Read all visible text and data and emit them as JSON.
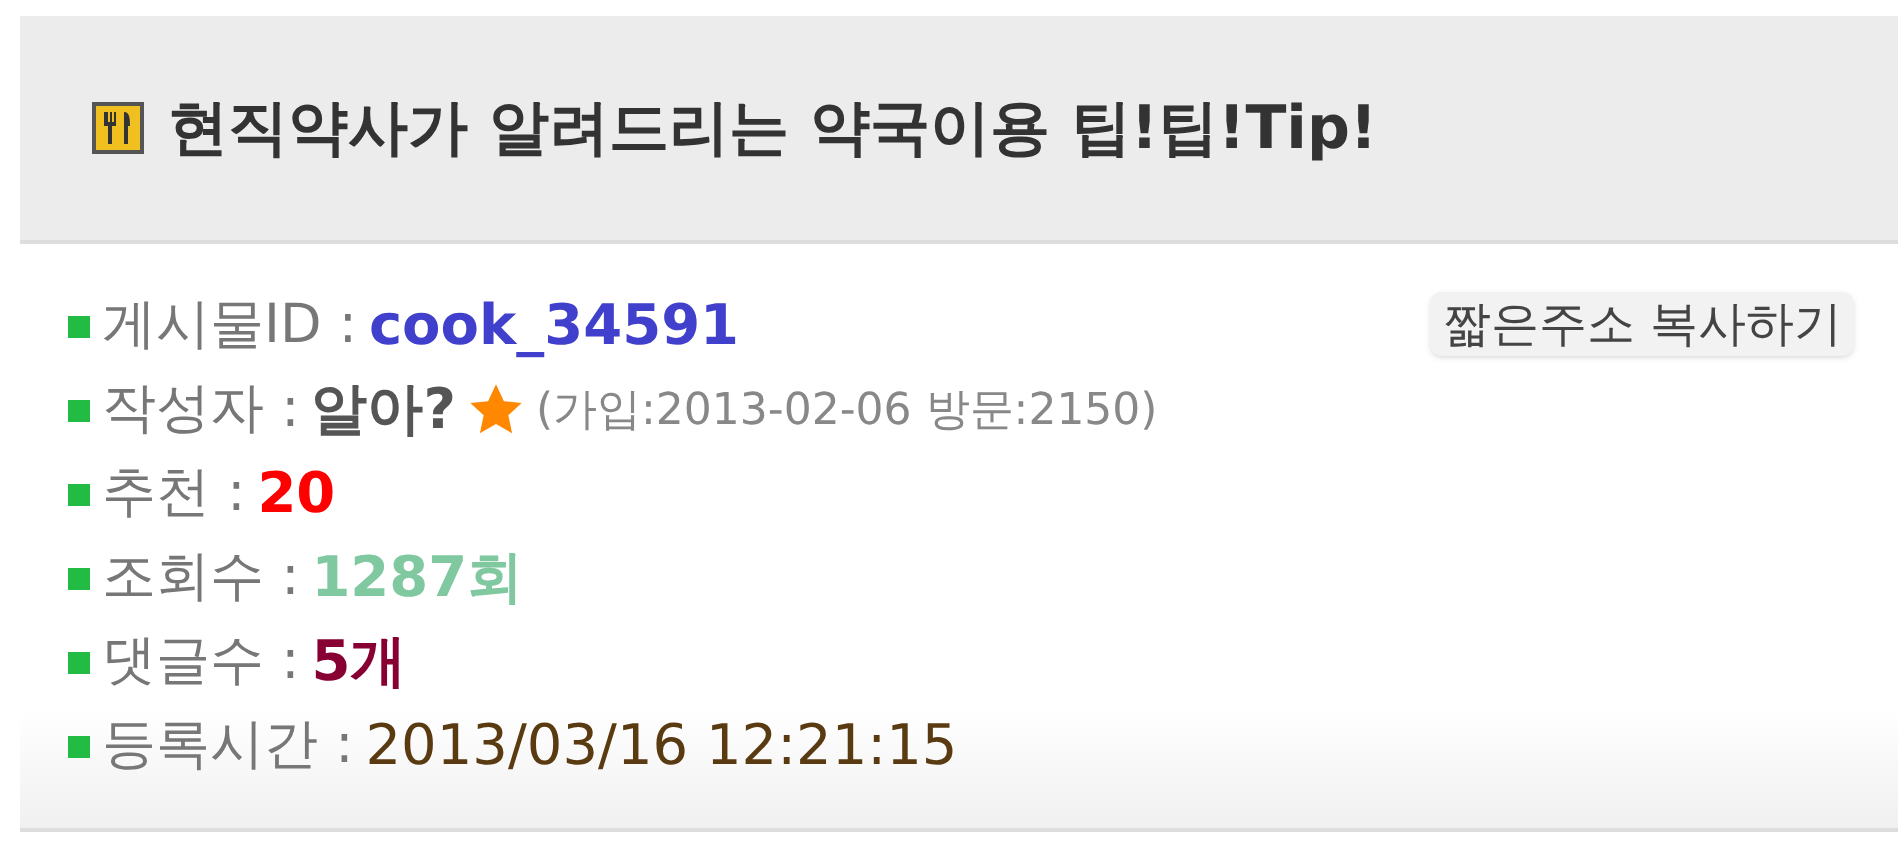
{
  "header": {
    "title": "현직약사가 알려드리는 약국이용 팁!팁!Tip!"
  },
  "copy_button": {
    "label": "짧은주소 복사하기"
  },
  "rows": [
    {
      "kind": "bold",
      "label": "게시물ID :",
      "value": "cook_34591",
      "color": "#4040cc"
    },
    {
      "kind": "author",
      "label": "작성자 :",
      "value": "알아?",
      "color": "#555555",
      "note": "(가입:2013-02-06 방문:2150)"
    },
    {
      "kind": "bold",
      "label": "추천 :",
      "value": "20",
      "color": "#ff0000"
    },
    {
      "kind": "bold",
      "label": "조회수 :",
      "value": "1287회",
      "color": "#80c8a0"
    },
    {
      "kind": "bold",
      "label": "댓글수 :",
      "value": "5개",
      "color": "#880033"
    },
    {
      "kind": "plain",
      "label": "등록시간 :",
      "value": "2013/03/16 12:21:15",
      "color": "#5a3a10"
    }
  ]
}
